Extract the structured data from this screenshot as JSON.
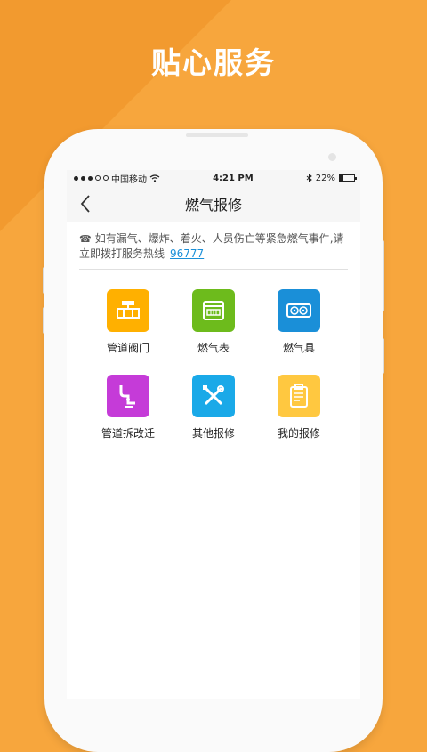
{
  "promo_title": "贴心服务",
  "status": {
    "carrier": "中国移动",
    "time": "4:21 PM",
    "battery": "22%",
    "battery_level": 0.22
  },
  "nav": {
    "title": "燃气报修"
  },
  "notice": {
    "text": "如有漏气、爆炸、着火、人员伤亡等紧急燃气事件,请立即拨打服务热线",
    "hotline": "96777"
  },
  "services": [
    {
      "label": "管道阀门",
      "icon": "pipe-valve-icon",
      "color": "#ffb000"
    },
    {
      "label": "燃气表",
      "icon": "gas-meter-icon",
      "color": "#6dbb1c"
    },
    {
      "label": "燃气具",
      "icon": "gas-stove-icon",
      "color": "#1a8fd8"
    },
    {
      "label": "管道拆改迁",
      "icon": "pipe-relocation-icon",
      "color": "#c53bd8"
    },
    {
      "label": "其他报修",
      "icon": "tools-icon",
      "color": "#1aa9e8"
    },
    {
      "label": "我的报修",
      "icon": "repair-list-icon",
      "color": "#ffc840"
    }
  ]
}
